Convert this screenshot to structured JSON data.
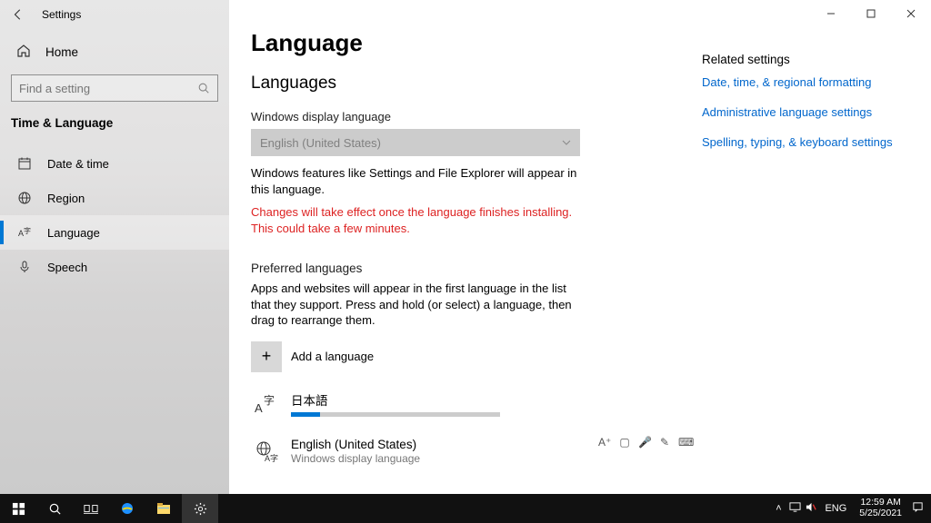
{
  "titlebar": {
    "title": "Settings"
  },
  "home": {
    "label": "Home"
  },
  "search": {
    "placeholder": "Find a setting"
  },
  "category": "Time & Language",
  "nav": [
    {
      "label": "Date & time"
    },
    {
      "label": "Region"
    },
    {
      "label": "Language"
    },
    {
      "label": "Speech"
    }
  ],
  "page": {
    "h1": "Language",
    "h2": "Languages",
    "displayLangLabel": "Windows display language",
    "displayLangValue": "English (United States)",
    "displayDesc": "Windows features like Settings and File Explorer will appear in this language.",
    "warning": "Changes will take effect once the language finishes installing. This could take a few minutes.",
    "prefHeader": "Preferred languages",
    "prefDesc": "Apps and websites will appear in the first language in the list that they support. Press and hold (or select) a language, then drag to rearrange them.",
    "addLabel": "Add a language",
    "langs": [
      {
        "name": "日本語",
        "sub": "",
        "progress": true
      },
      {
        "name": "English (United States)",
        "sub": "Windows display language",
        "features": true
      }
    ]
  },
  "related": {
    "title": "Related settings",
    "links": [
      "Date, time, & regional formatting",
      "Administrative language settings",
      "Spelling, typing, & keyboard settings"
    ]
  },
  "taskbar": {
    "lang": "ENG",
    "time": "12:59 AM",
    "date": "5/25/2021"
  }
}
